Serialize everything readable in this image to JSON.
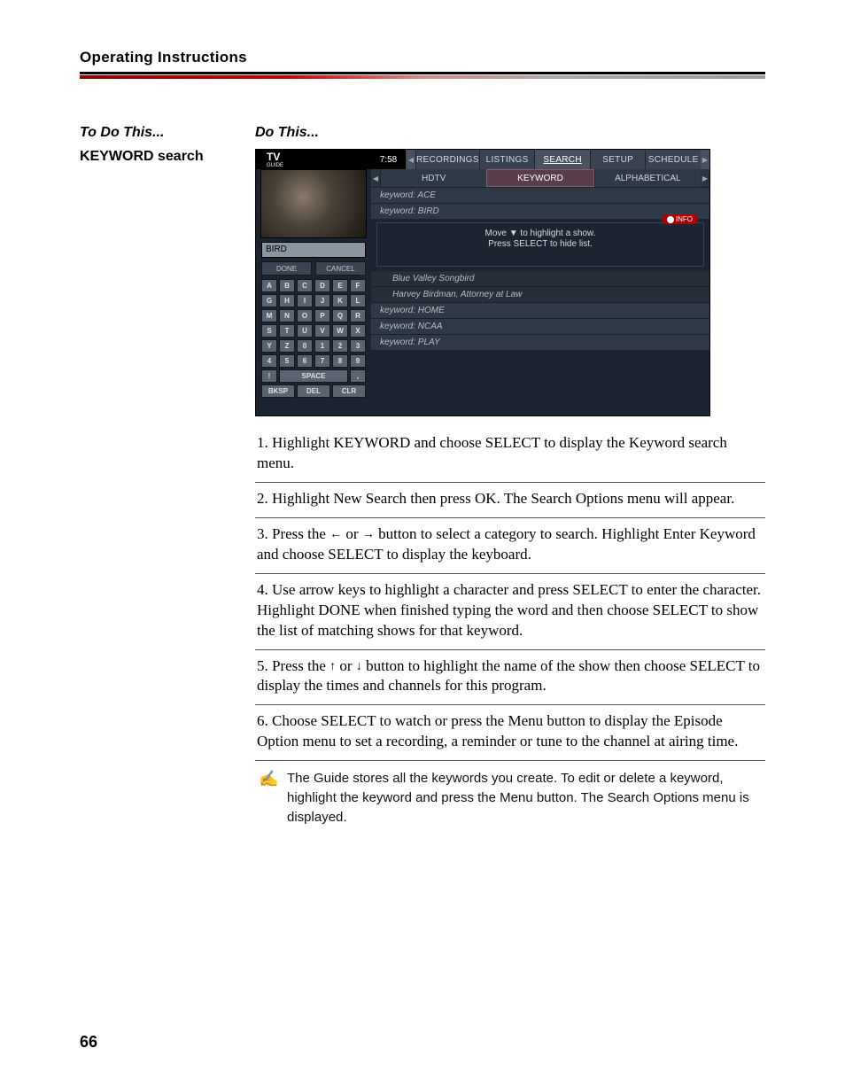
{
  "header": {
    "title": "Operating Instructions"
  },
  "columns": {
    "left_heading": "To Do This...",
    "right_heading": "Do This...",
    "row_label": "KEYWORD search"
  },
  "tv": {
    "logo_main": "TV",
    "logo_sub": "GUIDE",
    "time": "7:58",
    "tabs": [
      "RECORDINGS",
      "LISTINGS",
      "SEARCH",
      "SETUP",
      "SCHEDULE"
    ],
    "tabs_selected_index": 2,
    "subtabs": [
      "HDTV",
      "KEYWORD",
      "ALPHABETICAL"
    ],
    "subtabs_selected_index": 1,
    "input_value": "BIRD",
    "btn_done": "DONE",
    "btn_cancel": "CANCEL",
    "keys": [
      "A",
      "B",
      "C",
      "D",
      "E",
      "F",
      "G",
      "H",
      "I",
      "J",
      "K",
      "L",
      "M",
      "N",
      "O",
      "P",
      "Q",
      "R",
      "S",
      "T",
      "U",
      "V",
      "W",
      "X",
      "Y",
      "Z",
      "0",
      "1",
      "2",
      "3",
      "4",
      "5",
      "6",
      "7",
      "8",
      "9"
    ],
    "special_keys": {
      "left_sym": "!",
      "space": "SPACE",
      "right_sym": ",",
      "bksp": "BKSP",
      "del": "DEL",
      "clr": "CLR"
    },
    "keyword_rows_top": [
      "keyword: ACE",
      "keyword: BIRD"
    ],
    "hint_line1": "Move ▼ to highlight a show.",
    "hint_line2": "Press SELECT to hide list.",
    "info_badge": "INFO",
    "result_rows": [
      "Blue Valley Songbird",
      "Harvey Birdman, Attorney at Law"
    ],
    "keyword_rows_bottom": [
      "keyword: HOME",
      "keyword: NCAA",
      "keyword: PLAY"
    ]
  },
  "steps": [
    {
      "num": "1.",
      "body": "Highlight KEYWORD and choose SELECT to display the Keyword search menu."
    },
    {
      "num": "2.",
      "body": "Highlight New Search then press OK. The Search Options menu will appear."
    },
    {
      "num": "3.",
      "pre": "Press the ",
      "g1": "←",
      "mid": " or ",
      "g2": "→",
      "post": " button to select a category to search. Highlight Enter Keyword and choose SELECT to display the keyboard."
    },
    {
      "num": "4.",
      "body": "Use arrow keys to highlight a character and press SELECT to enter the character. Highlight DONE when finished typing the word and then choose SELECT to show the list of matching shows for that keyword."
    },
    {
      "num": "5.",
      "pre": "Press the ",
      "g1": "↑",
      "mid": " or ",
      "g2": "↓",
      "post": " button to highlight the name of the show then choose SELECT to display the times and channels for this program."
    },
    {
      "num": "6.",
      "body": "Choose SELECT to watch or press the Menu button to display the Episode Option menu to set a recording, a reminder or tune to the channel at airing time."
    }
  ],
  "note": {
    "icon": "✍",
    "text": "The Guide stores all the keywords you create. To edit or delete a keyword, highlight the keyword and press the Menu button. The Search Options menu is displayed."
  },
  "page_number": "66"
}
